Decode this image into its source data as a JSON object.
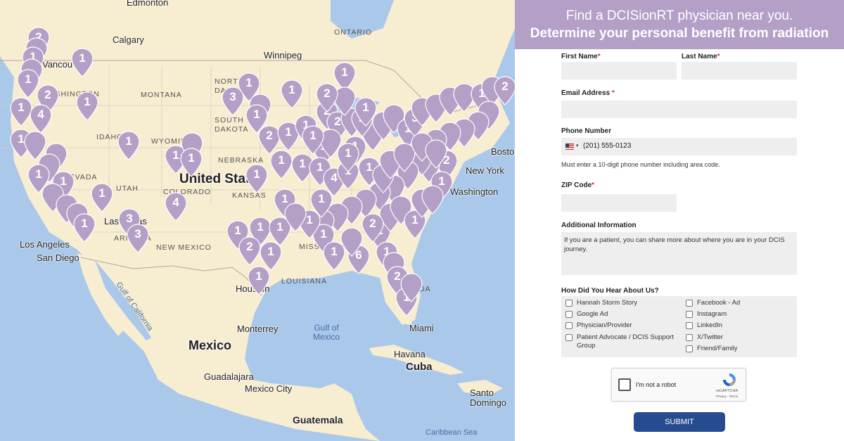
{
  "map": {
    "cities": [
      "Edmonton",
      "Calgary",
      "Winnipeg",
      "Vancouver",
      "Los Angeles",
      "San Diego",
      "Las Vegas",
      "Monterrey",
      "Houston",
      "Guadalajara",
      "Mexico City",
      "Havana",
      "Miami",
      "Boston",
      "New York",
      "Washington",
      "Santo Domingo"
    ],
    "states": [
      "ONTARIO",
      "MONTANA",
      "NORTH DAKOTA",
      "SOUTH DAKOTA",
      "NEBRASKA",
      "IDAHO",
      "WYOMING",
      "NEVADA",
      "UTAH",
      "COLORADO",
      "KANSAS",
      "ARIZONA",
      "NEW MEXICO",
      "MISSISSIPPI",
      "LOUISIANA",
      "FLORIDA",
      "WASHINGTON"
    ],
    "countries": [
      "United States",
      "Mexico",
      "Cuba",
      "Guatemala"
    ],
    "waters": [
      "Gulf of Mexico",
      "Gulf of California",
      "Caribbean Sea"
    ],
    "pin_color": "#b49fc6"
  },
  "header": {
    "line1": "Find a DCISionRT physician near you.",
    "line2": "Determine your personal benefit from radiation",
    "background": "#b49fc6"
  },
  "form": {
    "first_name_label": "First Name",
    "last_name_label": "Last Name",
    "email_label": "Email Address",
    "phone_label": "Phone Number",
    "phone_placeholder": "(201) 555-0123",
    "phone_hint": "Must enter a 10-digit phone number including area code.",
    "zip_label": "ZIP Code",
    "additional_label": "Additional Information",
    "additional_placeholder": "If you are a patient, you can share more about where you are in your DCIS journey.",
    "hear_label": "How Did You Hear About Us?",
    "options_left": [
      "Hannah Storm Story",
      "Google Ad",
      "Physician/Provider",
      "Patient Advocate / DCIS Support Group"
    ],
    "options_right": [
      "Facebook - Ad",
      "Instagram",
      "LinkedIn",
      "X/Twitter",
      "Friend/Family"
    ],
    "required_mark": "*",
    "recaptcha_label": "I'm not a robot",
    "recaptcha_brand": "reCAPTCHA",
    "recaptcha_links": "Privacy - Terms",
    "submit_label": "SUBMIT",
    "submit_color": "#264c8f"
  }
}
